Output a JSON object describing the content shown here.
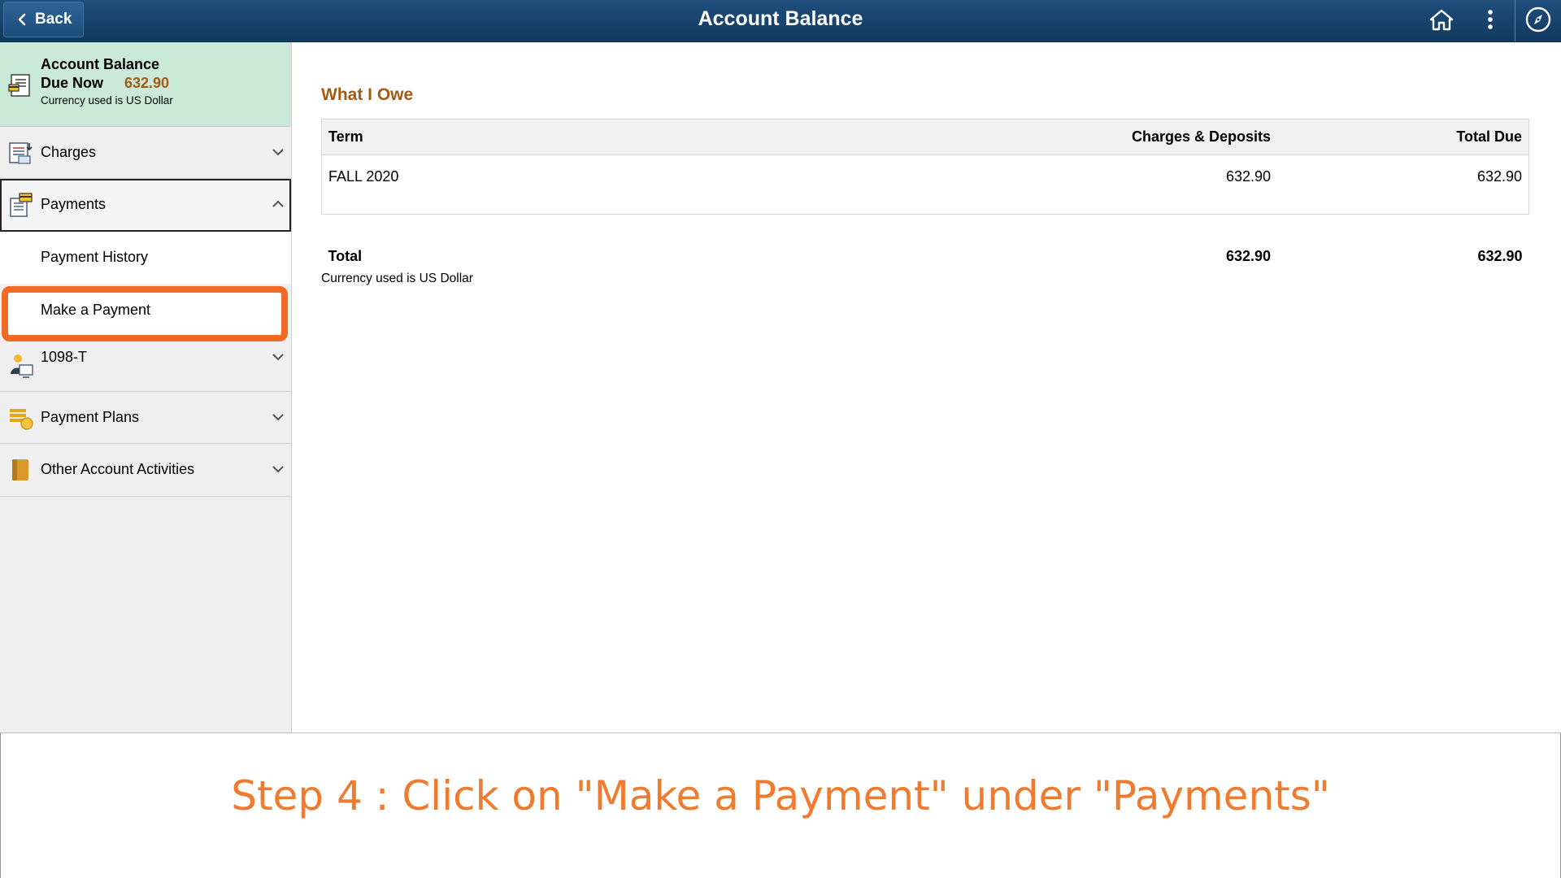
{
  "header": {
    "back_label": "Back",
    "title": "Account Balance",
    "icons": [
      "home-icon",
      "actions-menu-icon",
      "navbar-compass-icon"
    ]
  },
  "sidebar": {
    "summary": {
      "title": "Account Balance",
      "due_label": "Due Now",
      "due_amount": "632.90",
      "currency_note": "Currency used is US Dollar"
    },
    "items": [
      {
        "label": "Charges",
        "icon": "charges-icon",
        "expanded": false
      },
      {
        "label": "Payments",
        "icon": "payments-icon",
        "expanded": true,
        "children": [
          {
            "label": "Payment History"
          },
          {
            "label": "Make a Payment"
          }
        ]
      },
      {
        "label": "1098-T",
        "icon": "tax-form-icon",
        "expanded": false
      },
      {
        "label": "Payment Plans",
        "icon": "payment-plans-icon",
        "expanded": false
      },
      {
        "label": "Other Account Activities",
        "icon": "account-activities-icon",
        "expanded": false
      }
    ]
  },
  "main": {
    "section_title": "What I Owe",
    "table": {
      "headers": [
        "Term",
        "Charges & Deposits",
        "Total Due"
      ],
      "rows": [
        {
          "term": "FALL 2020",
          "charges": "632.90",
          "total_due": "632.90"
        }
      ],
      "total": {
        "label": "Total",
        "charges": "632.90",
        "total_due": "632.90"
      }
    },
    "currency_note": "Currency used is US Dollar"
  },
  "caption": "Step 4 : Click on \"Make a Payment\" under \"Payments\"",
  "colors": {
    "header_bg": "#1a466f",
    "summary_bg": "#cbe9d8",
    "accent_brown": "#a35a14",
    "highlight_orange": "#f06a23",
    "caption_orange": "#f07a2e"
  }
}
